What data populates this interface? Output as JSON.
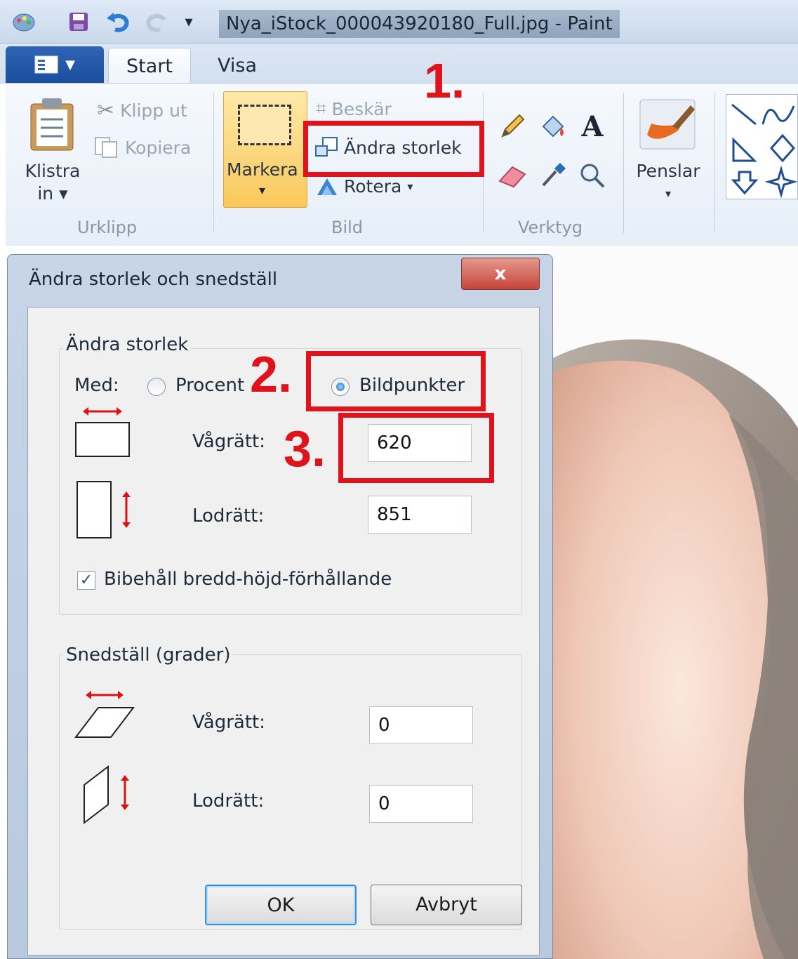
{
  "window": {
    "title": "Nya_iStock_000043920180_Full.jpg - Paint"
  },
  "tabs": [
    {
      "label": "Start",
      "active": true
    },
    {
      "label": "Visa",
      "active": false
    }
  ],
  "ribbon": {
    "clipboard": {
      "paste_line1": "Klistra",
      "paste_line2": "in",
      "cut": "Klipp ut",
      "copy": "Kopiera",
      "group_label": "Urklipp"
    },
    "image": {
      "select": "Markera",
      "crop": "Beskär",
      "resize": "Ändra storlek",
      "rotate": "Rotera",
      "group_label": "Bild"
    },
    "tools": {
      "group_label": "Verktyg"
    },
    "brushes": {
      "label": "Penslar"
    }
  },
  "annotations": {
    "step1": "1.",
    "step2": "2.",
    "step3": "3.",
    "color": "#e0121b"
  },
  "dialog": {
    "title": "Ändra storlek och snedställ",
    "close_label": "x",
    "resize_group": {
      "title": "Ändra storlek",
      "by_label": "Med:",
      "option_percent": "Procent",
      "option_pixels": "Bildpunkter",
      "selected": "Bildpunkter",
      "horizontal_label": "Vågrätt:",
      "horizontal_value": "620",
      "vertical_label": "Lodrätt:",
      "vertical_value": "851",
      "keep_ratio_label": "Bibehåll bredd-höjd-förhållande",
      "keep_ratio_checked": true
    },
    "skew_group": {
      "title": "Snedställ (grader)",
      "horizontal_label": "Vågrätt:",
      "horizontal_value": "0",
      "vertical_label": "Lodrätt:",
      "vertical_value": "0"
    },
    "ok_label": "OK",
    "cancel_label": "Avbryt"
  }
}
